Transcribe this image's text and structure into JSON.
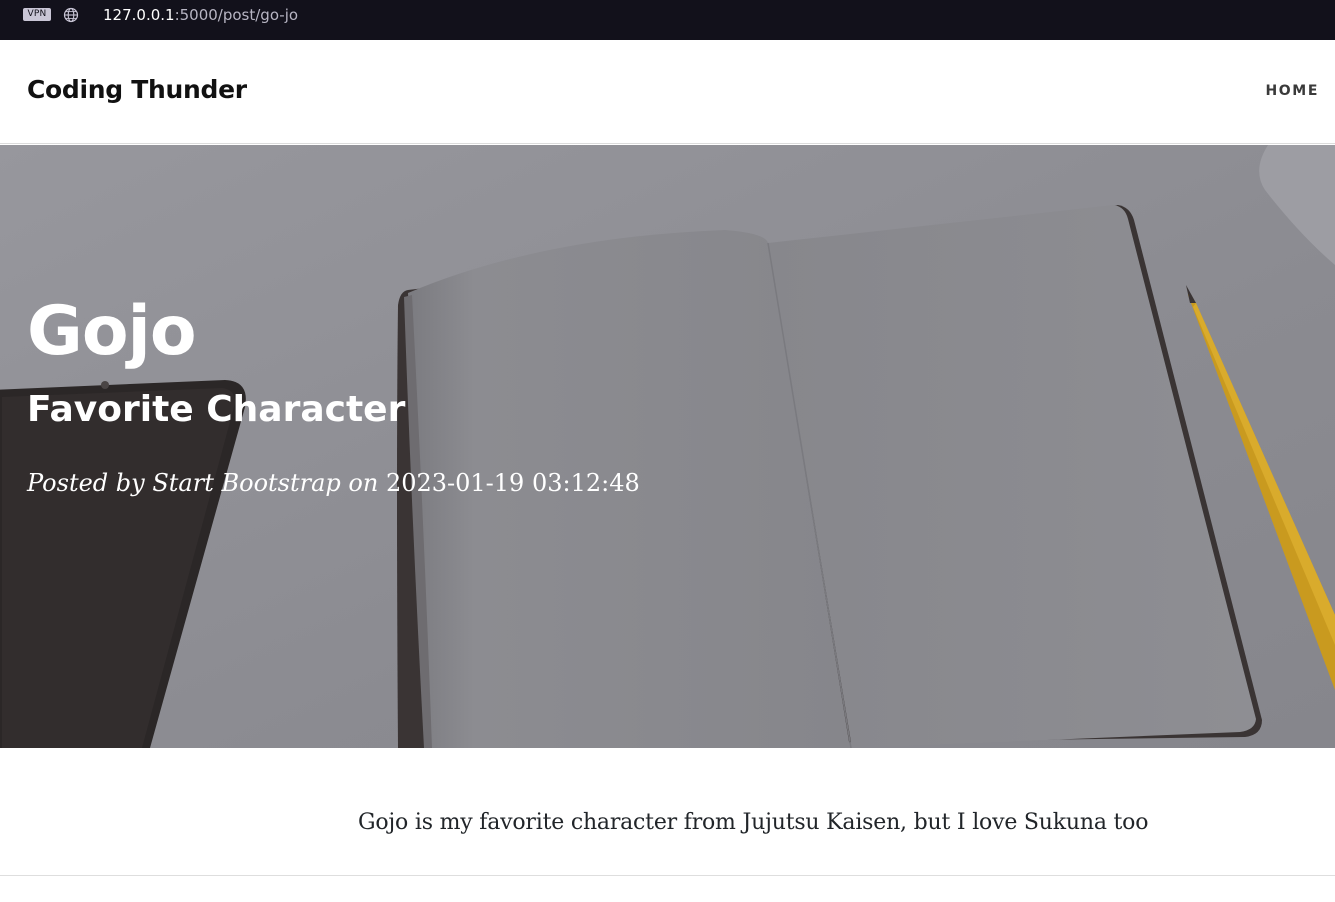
{
  "browser": {
    "vpn_label": "VPN",
    "url_host": "127.0.0.1",
    "url_path": ":5000/post/go-jo"
  },
  "navbar": {
    "brand": "Coding Thunder",
    "home_label": "HOME"
  },
  "post": {
    "title": "Gojo",
    "subtitle": "Favorite Character",
    "meta_prefix": "Posted by ",
    "author": "Start Bootstrap",
    "meta_on": " on ",
    "date": "2023-01-19 03:12:48",
    "body": "Gojo is my favorite character from Jujutsu Kaisen, but I love Sukuna too"
  },
  "colors": {
    "address_bar": "#12111b",
    "hero_overlay": "#8d8d93",
    "text_dark": "#212529"
  }
}
